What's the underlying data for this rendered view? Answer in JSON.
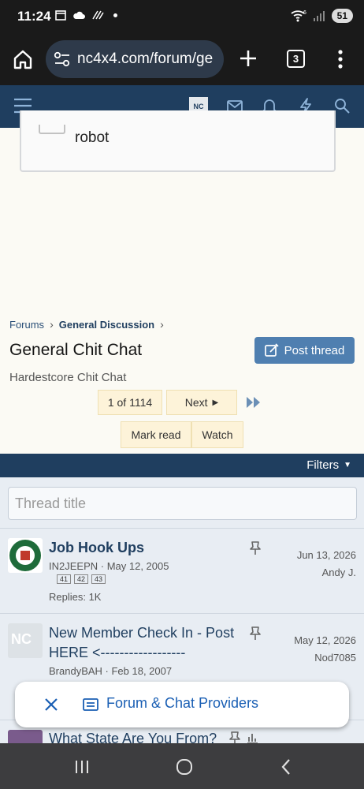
{
  "status": {
    "time": "11:24",
    "battery": "51",
    "signal_sup": "6"
  },
  "browser": {
    "url": "nc4x4.com/forum/ge",
    "tab_count": "3"
  },
  "site": {
    "logo_text": "NC"
  },
  "captcha": {
    "label": "robot"
  },
  "breadcrumb": {
    "forums": "Forums",
    "current": "General Discussion"
  },
  "forum": {
    "title": "General Chit Chat",
    "post_button": "Post thread",
    "subtitle": "Hardestcore Chit Chat"
  },
  "pagination": {
    "current": "1 of 1114",
    "next": "Next",
    "mark_read": "Mark read",
    "watch": "Watch"
  },
  "filters": {
    "label": "Filters"
  },
  "search": {
    "placeholder": "Thread title"
  },
  "threads": [
    {
      "title": "Job Hook Ups",
      "author": "IN2JEEPN",
      "date": "May 12, 2005",
      "pages": [
        "41",
        "42",
        "43"
      ],
      "replies": "Replies: 1K",
      "last_date": "Jun 13, 2026",
      "last_user": "Andy J."
    },
    {
      "title_line1": "New Member Check In - Post",
      "title_line2": "HERE <------------------",
      "author": "BrandyBAH",
      "date": "Feb 18, 2007",
      "last_date": "May 12, 2026",
      "last_user": "Nod7085"
    },
    {
      "title": "What State Are You From?"
    }
  ],
  "snackbar": {
    "label": "Forum & Chat Providers"
  },
  "icons": [
    "home-icon",
    "plus-icon",
    "tabs-icon",
    "overflow-menu-icon",
    "hamburger-icon",
    "mail-icon",
    "bell-icon",
    "bolt-icon",
    "search-icon",
    "pin-icon",
    "close-icon"
  ],
  "colors": {
    "nav_blue": "#1f3e5f",
    "button_blue": "#4f7fb0",
    "page_bg": "#fbfaf4",
    "pager_bg": "#fdf3d9",
    "link_blue": "#1a5fb4"
  }
}
